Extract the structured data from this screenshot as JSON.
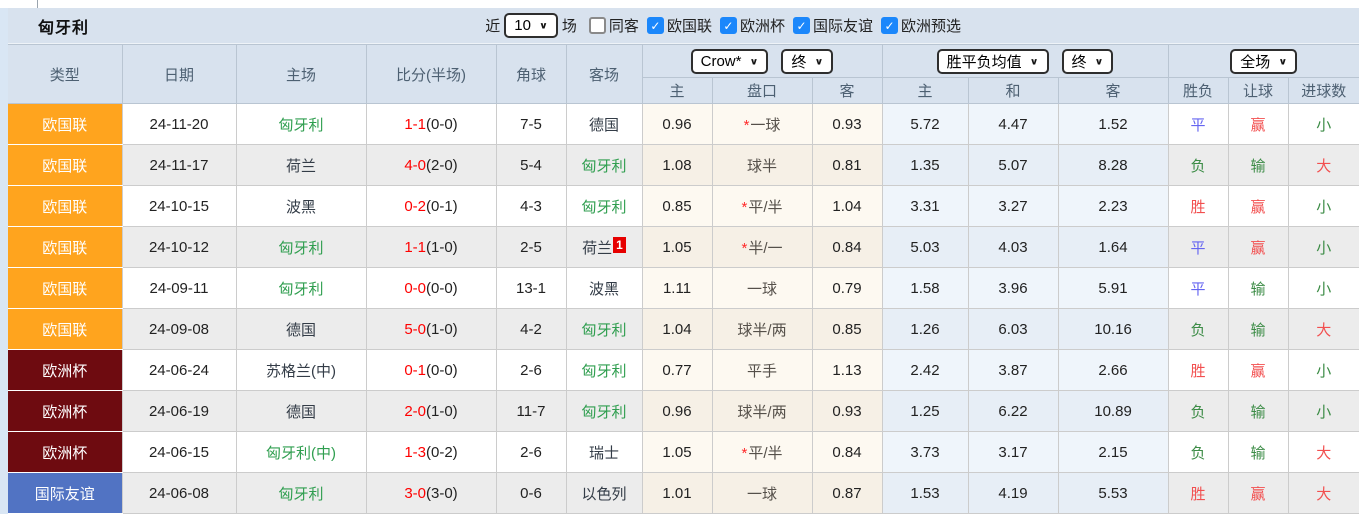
{
  "title_bar": {
    "team": "匈牙利",
    "near_label": "近",
    "count_value": "10",
    "unit_label": "场",
    "filters": [
      {
        "label": "同客",
        "checked": false
      },
      {
        "label": "欧国联",
        "checked": true
      },
      {
        "label": "欧洲杯",
        "checked": true
      },
      {
        "label": "国际友谊",
        "checked": true
      },
      {
        "label": "欧洲预选",
        "checked": true
      }
    ]
  },
  "table": {
    "columns": [
      "类型",
      "日期",
      "主场",
      "比分(半场)",
      "角球",
      "客场"
    ],
    "selects": {
      "company": "Crow*",
      "company_time": "终",
      "avg": "胜平负均值",
      "avg_time": "终",
      "scope": "全场"
    },
    "sub_columns": [
      "主",
      "盘口",
      "客",
      "主",
      "和",
      "客",
      "胜负",
      "让球",
      "进球数"
    ],
    "league_colors": {
      "欧国联": "#ffa41e",
      "欧洲杯": "#6e0b10",
      "国际友谊": "#5173c3"
    },
    "rows": [
      {
        "type": "欧国联",
        "type_bg": "#ffa41e",
        "date": "24-11-20",
        "home": "匈牙利",
        "home_cls": "t-green",
        "score": "1-1",
        "half": "(0-0)",
        "corners": "7-5",
        "away": "德国",
        "away_cls": "t-dark",
        "away_badge": null,
        "odds_home": "0.96",
        "handicap_star": true,
        "handicap": "一球",
        "odds_away": "0.93",
        "avg_home": "5.72",
        "avg_draw": "4.47",
        "avg_away": "1.52",
        "wdl": "平",
        "wdl_cls": "r-blue",
        "let_res": "赢",
        "let_cls": "r-red",
        "goals": "小",
        "goals_cls": "r-green"
      },
      {
        "type": "欧国联",
        "type_bg": "#ffa41e",
        "date": "24-11-17",
        "home": "荷兰",
        "home_cls": "t-dark",
        "score": "4-0",
        "half": "(2-0)",
        "corners": "5-4",
        "away": "匈牙利",
        "away_cls": "t-green",
        "away_badge": null,
        "odds_home": "1.08",
        "handicap_star": false,
        "handicap": "球半",
        "odds_away": "0.81",
        "avg_home": "1.35",
        "avg_draw": "5.07",
        "avg_away": "8.28",
        "wdl": "负",
        "wdl_cls": "r-green",
        "let_res": "输",
        "let_cls": "r-green",
        "goals": "大",
        "goals_cls": "r-red"
      },
      {
        "type": "欧国联",
        "type_bg": "#ffa41e",
        "date": "24-10-15",
        "home": "波黑",
        "home_cls": "t-dark",
        "score": "0-2",
        "half": "(0-1)",
        "corners": "4-3",
        "away": "匈牙利",
        "away_cls": "t-green",
        "away_badge": null,
        "odds_home": "0.85",
        "handicap_star": true,
        "handicap": "平/半",
        "odds_away": "1.04",
        "avg_home": "3.31",
        "avg_draw": "3.27",
        "avg_away": "2.23",
        "wdl": "胜",
        "wdl_cls": "r-red",
        "let_res": "赢",
        "let_cls": "r-red",
        "goals": "小",
        "goals_cls": "r-green"
      },
      {
        "type": "欧国联",
        "type_bg": "#ffa41e",
        "date": "24-10-12",
        "home": "匈牙利",
        "home_cls": "t-green",
        "score": "1-1",
        "half": "(1-0)",
        "corners": "2-5",
        "away": "荷兰",
        "away_cls": "t-dark",
        "away_badge": "1",
        "odds_home": "1.05",
        "handicap_star": true,
        "handicap": "半/一",
        "odds_away": "0.84",
        "avg_home": "5.03",
        "avg_draw": "4.03",
        "avg_away": "1.64",
        "wdl": "平",
        "wdl_cls": "r-blue",
        "let_res": "赢",
        "let_cls": "r-red",
        "goals": "小",
        "goals_cls": "r-green"
      },
      {
        "type": "欧国联",
        "type_bg": "#ffa41e",
        "date": "24-09-11",
        "home": "匈牙利",
        "home_cls": "t-green",
        "score": "0-0",
        "half": "(0-0)",
        "corners": "13-1",
        "away": "波黑",
        "away_cls": "t-dark",
        "away_badge": null,
        "odds_home": "1.11",
        "handicap_star": false,
        "handicap": "一球",
        "odds_away": "0.79",
        "avg_home": "1.58",
        "avg_draw": "3.96",
        "avg_away": "5.91",
        "wdl": "平",
        "wdl_cls": "r-blue",
        "let_res": "输",
        "let_cls": "r-green",
        "goals": "小",
        "goals_cls": "r-green"
      },
      {
        "type": "欧国联",
        "type_bg": "#ffa41e",
        "date": "24-09-08",
        "home": "德国",
        "home_cls": "t-dark",
        "score": "5-0",
        "half": "(1-0)",
        "corners": "4-2",
        "away": "匈牙利",
        "away_cls": "t-green",
        "away_badge": null,
        "odds_home": "1.04",
        "handicap_star": false,
        "handicap": "球半/两",
        "odds_away": "0.85",
        "avg_home": "1.26",
        "avg_draw": "6.03",
        "avg_away": "10.16",
        "wdl": "负",
        "wdl_cls": "r-green",
        "let_res": "输",
        "let_cls": "r-green",
        "goals": "大",
        "goals_cls": "r-red"
      },
      {
        "type": "欧洲杯",
        "type_bg": "#6e0b10",
        "date": "24-06-24",
        "home": "苏格兰(中)",
        "home_cls": "t-dark",
        "score": "0-1",
        "half": "(0-0)",
        "corners": "2-6",
        "away": "匈牙利",
        "away_cls": "t-green",
        "away_badge": null,
        "odds_home": "0.77",
        "handicap_star": false,
        "handicap": "平手",
        "odds_away": "1.13",
        "avg_home": "2.42",
        "avg_draw": "3.87",
        "avg_away": "2.66",
        "wdl": "胜",
        "wdl_cls": "r-red",
        "let_res": "赢",
        "let_cls": "r-red",
        "goals": "小",
        "goals_cls": "r-green"
      },
      {
        "type": "欧洲杯",
        "type_bg": "#6e0b10",
        "date": "24-06-19",
        "home": "德国",
        "home_cls": "t-dark",
        "score": "2-0",
        "half": "(1-0)",
        "corners": "11-7",
        "away": "匈牙利",
        "away_cls": "t-green",
        "away_badge": null,
        "odds_home": "0.96",
        "handicap_star": false,
        "handicap": "球半/两",
        "odds_away": "0.93",
        "avg_home": "1.25",
        "avg_draw": "6.22",
        "avg_away": "10.89",
        "wdl": "负",
        "wdl_cls": "r-green",
        "let_res": "输",
        "let_cls": "r-green",
        "goals": "小",
        "goals_cls": "r-green"
      },
      {
        "type": "欧洲杯",
        "type_bg": "#6e0b10",
        "date": "24-06-15",
        "home": "匈牙利(中)",
        "home_cls": "t-green",
        "score": "1-3",
        "half": "(0-2)",
        "corners": "2-6",
        "away": "瑞士",
        "away_cls": "t-dark",
        "away_badge": null,
        "odds_home": "1.05",
        "handicap_star": true,
        "handicap": "平/半",
        "odds_away": "0.84",
        "avg_home": "3.73",
        "avg_draw": "3.17",
        "avg_away": "2.15",
        "wdl": "负",
        "wdl_cls": "r-green",
        "let_res": "输",
        "let_cls": "r-green",
        "goals": "大",
        "goals_cls": "r-red"
      },
      {
        "type": "国际友谊",
        "type_bg": "#5173c3",
        "date": "24-06-08",
        "home": "匈牙利",
        "home_cls": "t-green",
        "score": "3-0",
        "half": "(3-0)",
        "corners": "0-6",
        "away": "以色列",
        "away_cls": "t-dark",
        "away_badge": null,
        "odds_home": "1.01",
        "handicap_star": false,
        "handicap": "一球",
        "odds_away": "0.87",
        "avg_home": "1.53",
        "avg_draw": "4.19",
        "avg_away": "5.53",
        "wdl": "胜",
        "wdl_cls": "r-red",
        "let_res": "赢",
        "let_cls": "r-red",
        "goals": "大",
        "goals_cls": "r-red"
      }
    ]
  }
}
